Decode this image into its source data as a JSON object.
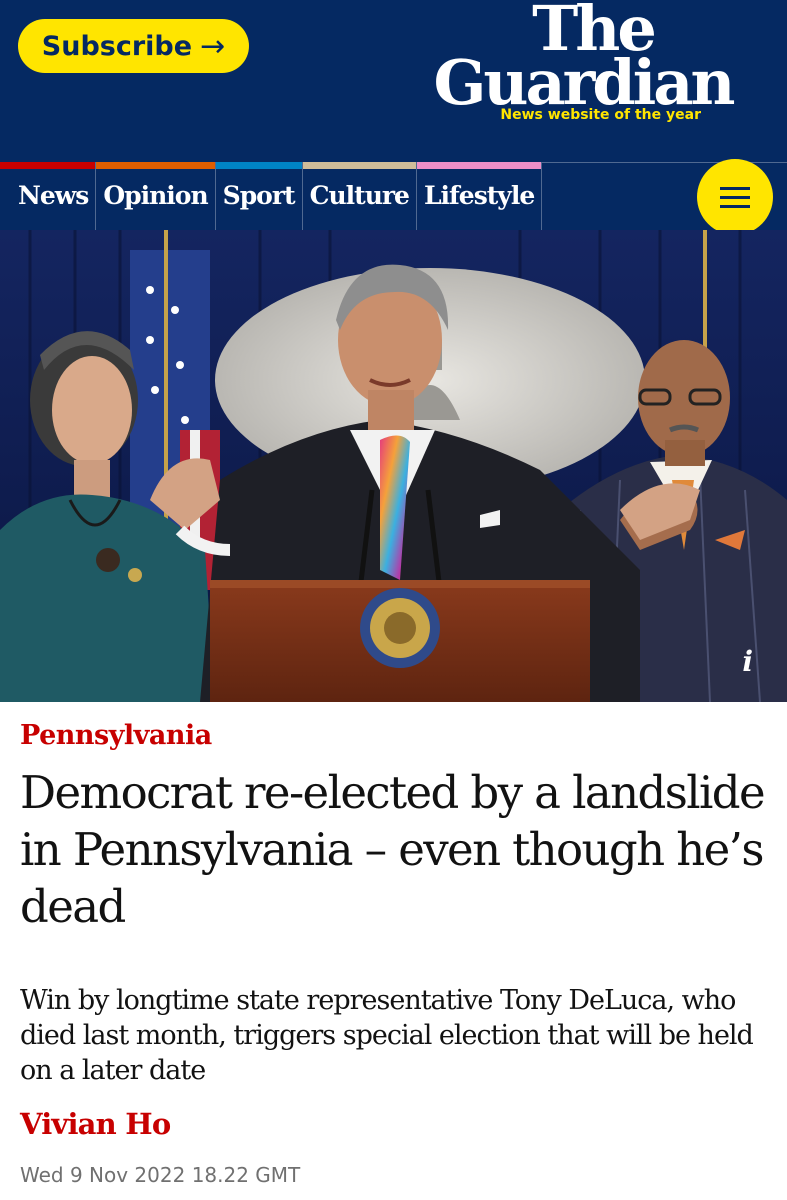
{
  "header": {
    "subscribe_label": "Subscribe",
    "subscribe_arrow": "→",
    "logo_line1": "The",
    "logo_line2": "Guardian",
    "tagline": "News website of the year",
    "background": "#052962",
    "accent": "#ffe500"
  },
  "nav": {
    "items": [
      {
        "label": "News",
        "color": "#c70000"
      },
      {
        "label": "Opinion",
        "color": "#e05e00"
      },
      {
        "label": "Sport",
        "color": "#0084c6"
      },
      {
        "label": "Culture",
        "color": "#a1845c"
      },
      {
        "label": "Lifestyle",
        "color": "#bb3b80"
      }
    ],
    "menu_icon": "hamburger-menu-icon"
  },
  "photo": {
    "info_label": "i"
  },
  "article": {
    "kicker": "Pennsylvania",
    "headline": "Democrat re-elected by a landslide in Pennsylvania – even though he’s dead",
    "standfirst": "Win by longtime state representative Tony DeLuca, who died last month, triggers special election that will be held on a later date",
    "byline": "Vivian Ho",
    "date": "Wed 9 Nov 2022 18.22 GMT",
    "kicker_color": "#c70000"
  }
}
